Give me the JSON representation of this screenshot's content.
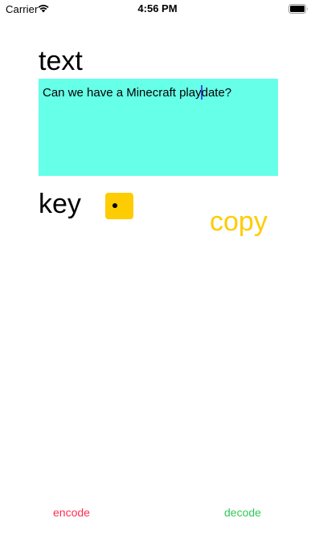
{
  "status_bar": {
    "carrier": "Carrier",
    "time": "4:56 PM",
    "wifi_icon": "wifi-icon",
    "battery_icon": "battery-icon"
  },
  "text_section": {
    "heading": "text",
    "value_before_caret": "Can we have a Minecraft play",
    "value_after_caret": "date?",
    "background_color": "#66ffe8"
  },
  "key_section": {
    "heading": "key",
    "dice_icon": "dice-one-icon",
    "dice_color": "#fecc02"
  },
  "actions": {
    "copy_label": "copy",
    "copy_color": "#fecc02",
    "encode_label": "encode",
    "encode_color": "#ff2d55",
    "decode_label": "decode",
    "decode_color": "#34c759"
  }
}
